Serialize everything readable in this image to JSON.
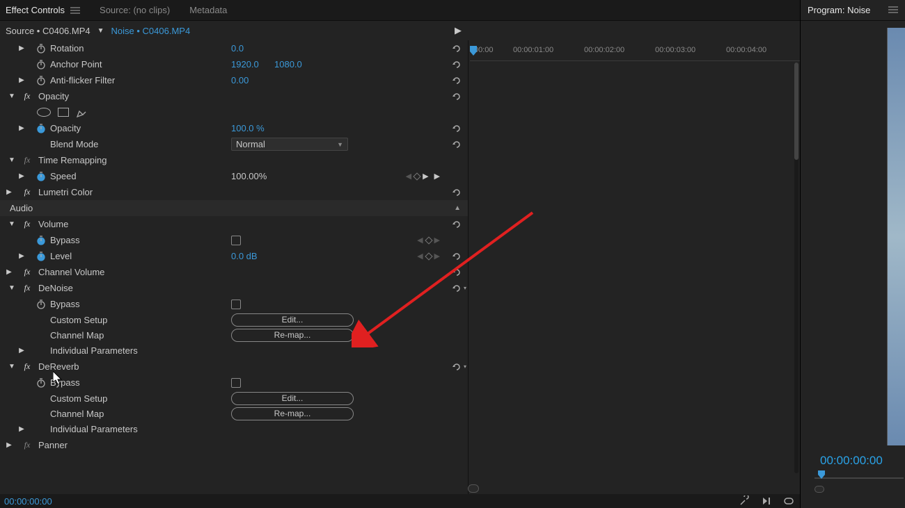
{
  "tabs": {
    "effect_controls": "Effect Controls",
    "source": "Source: (no clips)",
    "metadata": "Metadata"
  },
  "source_bar": {
    "source": "Source • C0406.MP4",
    "sequence": "Noise • C0406.MP4"
  },
  "timeline": {
    "marks": [
      "00:00",
      "00:00:01:00",
      "00:00:02:00",
      "00:00:03:00",
      "00:00:04:00"
    ],
    "playhead_pos": 0
  },
  "props": {
    "rotation": {
      "label": "Rotation",
      "value": "0.0"
    },
    "anchor_point": {
      "label": "Anchor Point",
      "x": "1920.0",
      "y": "1080.0"
    },
    "anti_flicker": {
      "label": "Anti-flicker Filter",
      "value": "0.00"
    },
    "opacity_fx": {
      "label": "Opacity"
    },
    "opacity": {
      "label": "Opacity",
      "value": "100.0 %"
    },
    "blend_mode": {
      "label": "Blend Mode",
      "value": "Normal"
    },
    "time_remap": {
      "label": "Time Remapping"
    },
    "speed": {
      "label": "Speed",
      "value": "100.00%"
    },
    "lumetri": {
      "label": "Lumetri Color"
    },
    "audio_hdr": "Audio",
    "volume": {
      "label": "Volume"
    },
    "bypass": "Bypass",
    "level": {
      "label": "Level",
      "value": "0.0 dB"
    },
    "channel_volume": {
      "label": "Channel Volume"
    },
    "denoise": {
      "label": "DeNoise"
    },
    "custom_setup": "Custom Setup",
    "channel_map": "Channel Map",
    "individual_params": "Individual Parameters",
    "dereverb": {
      "label": "DeReverb"
    },
    "panner": {
      "label": "Panner"
    },
    "edit_btn": "Edit...",
    "remap_btn": "Re-map..."
  },
  "status": {
    "timecode": "00:00:00:00"
  },
  "program": {
    "title": "Program: Noise",
    "timecode": "00:00:00:00"
  }
}
